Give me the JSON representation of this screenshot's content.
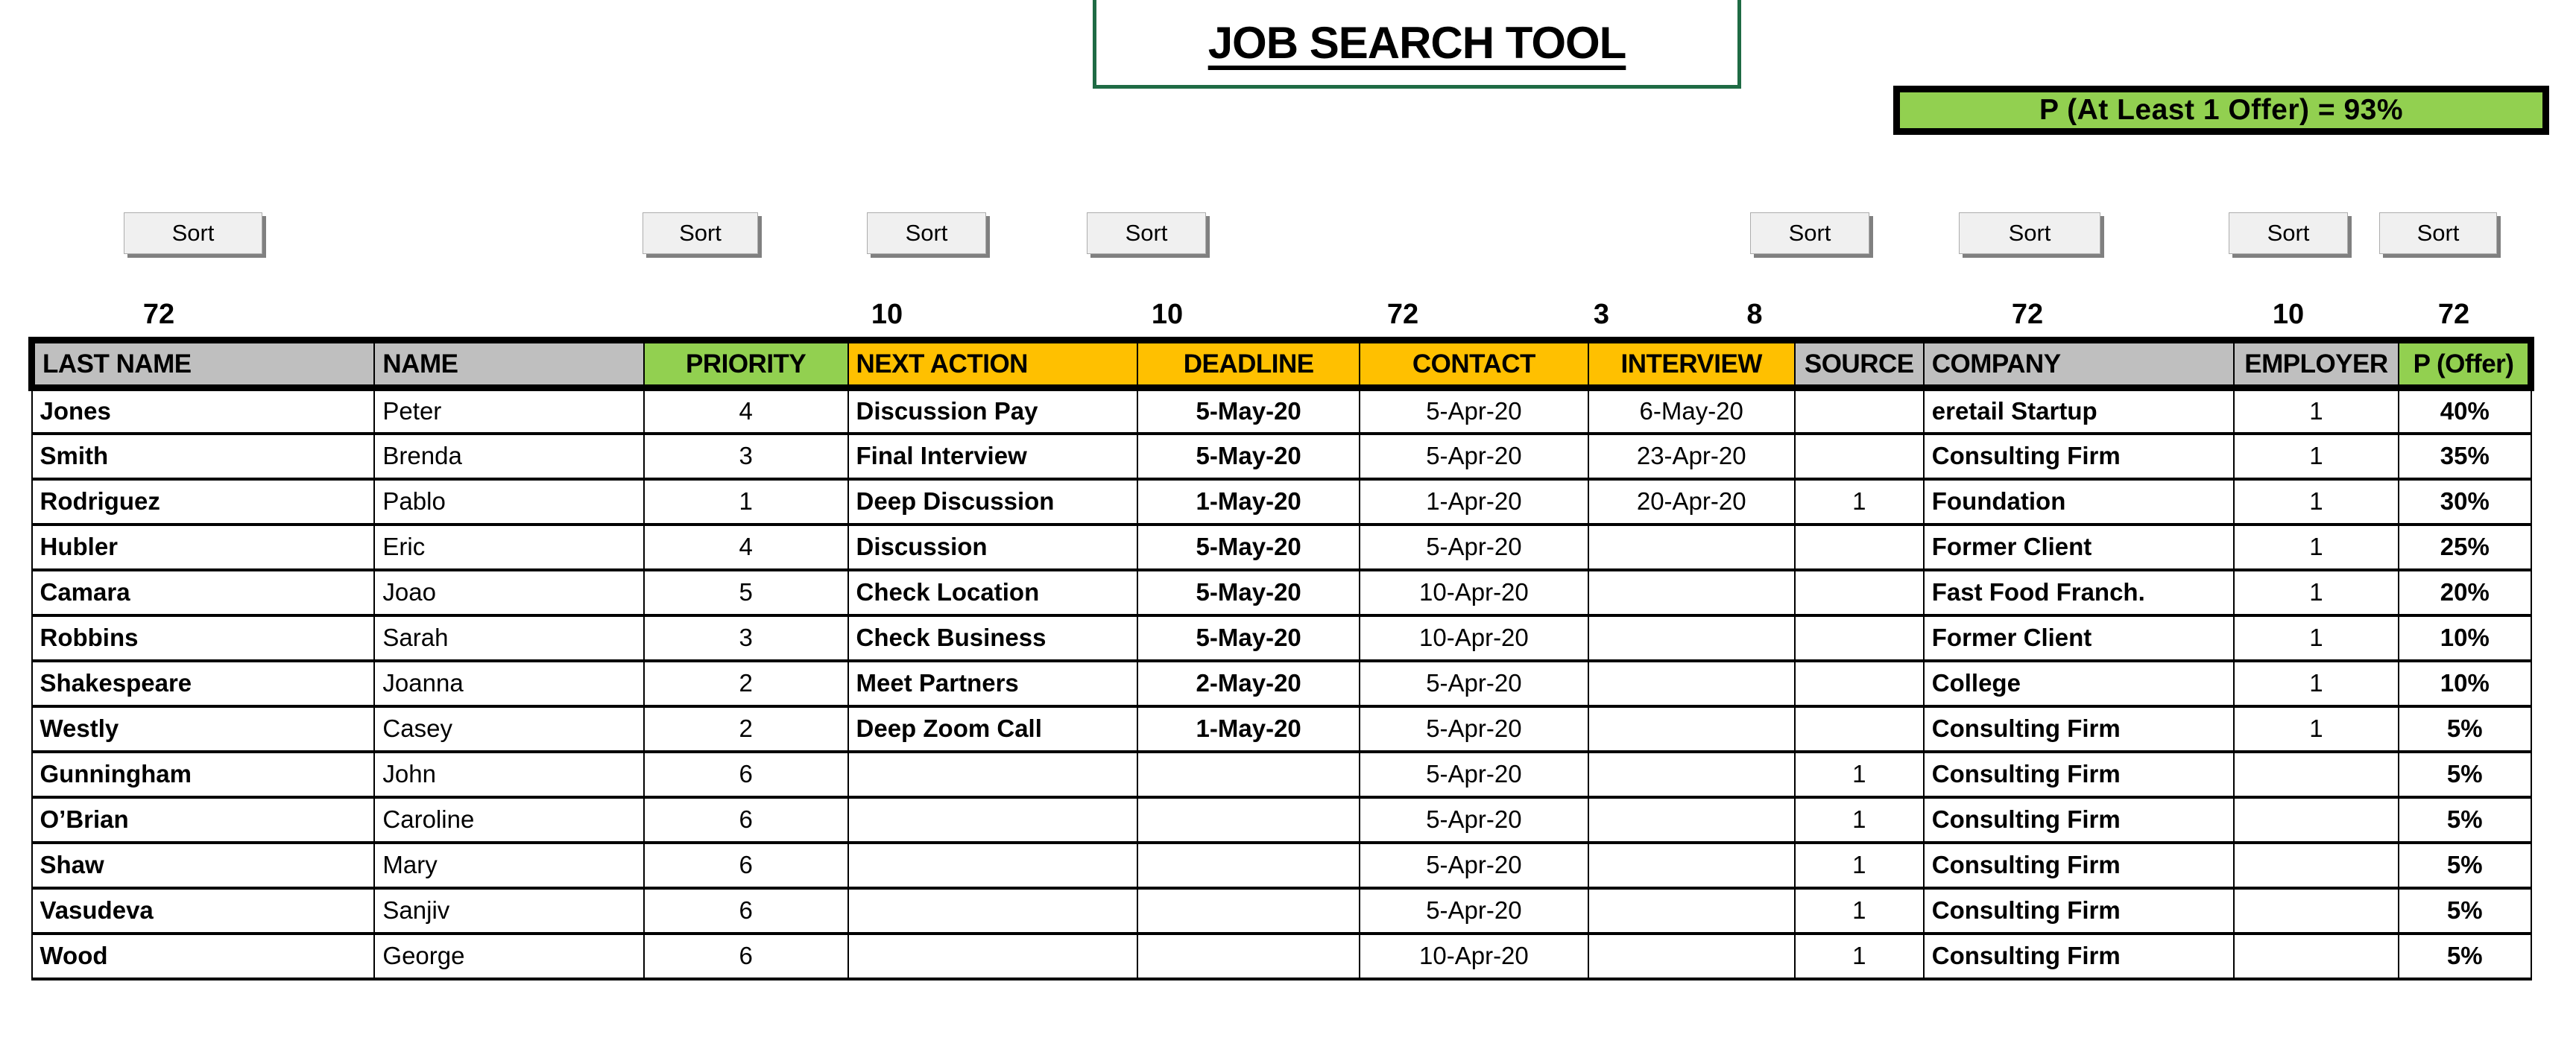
{
  "title": {
    "text": "JOB SEARCH TOOL"
  },
  "probability_banner": {
    "text": "P (At Least 1 Offer) = 93%"
  },
  "sort_label": "Sort",
  "sort_buttons": [
    {
      "column": "last-name",
      "label": "Sort"
    },
    {
      "column": "priority",
      "label": "Sort"
    },
    {
      "column": "next-action",
      "label": "Sort"
    },
    {
      "column": "deadline",
      "label": "Sort"
    },
    {
      "column": "source",
      "label": "Sort"
    },
    {
      "column": "company",
      "label": "Sort"
    },
    {
      "column": "employer",
      "label": "Sort"
    },
    {
      "column": "p-offer",
      "label": "Sort"
    }
  ],
  "counts": {
    "last_name": "72",
    "next_action": "10",
    "deadline": "10",
    "contact": "72",
    "interview": "3",
    "source": "8",
    "company": "72",
    "employer": "10",
    "p_offer": "72"
  },
  "table": {
    "columns": [
      {
        "key": "last_name",
        "label": "LAST NAME",
        "color": "#BFBFBF",
        "align": "left",
        "bold_cells": true
      },
      {
        "key": "name",
        "label": "NAME",
        "color": "#BFBFBF",
        "align": "left",
        "bold_cells": false
      },
      {
        "key": "priority",
        "label": "PRIORITY",
        "color": "#92D050",
        "align": "center",
        "bold_cells": false
      },
      {
        "key": "next_action",
        "label": "NEXT ACTION",
        "color": "#FFC000",
        "align": "left",
        "bold_cells": true
      },
      {
        "key": "deadline",
        "label": "DEADLINE",
        "color": "#FFC000",
        "align": "center",
        "bold_cells": true
      },
      {
        "key": "contact",
        "label": "CONTACT",
        "color": "#FFC000",
        "align": "center",
        "bold_cells": false
      },
      {
        "key": "interview",
        "label": "INTERVIEW",
        "color": "#FFC000",
        "align": "center",
        "bold_cells": false
      },
      {
        "key": "source",
        "label": "SOURCE",
        "color": "#BFBFBF",
        "align": "center",
        "bold_cells": false
      },
      {
        "key": "company",
        "label": "COMPANY",
        "color": "#BFBFBF",
        "align": "left",
        "bold_cells": true
      },
      {
        "key": "employer",
        "label": "EMPLOYER",
        "color": "#BFBFBF",
        "align": "center",
        "bold_cells": false
      },
      {
        "key": "p_offer",
        "label": "P (Offer)",
        "color": "#92D050",
        "align": "center",
        "bold_cells": true
      }
    ],
    "rows": [
      {
        "last_name": "Jones",
        "name": "Peter",
        "priority": "4",
        "next_action": "Discussion Pay",
        "deadline": "5-May-20",
        "contact": "5-Apr-20",
        "interview": "6-May-20",
        "source": "",
        "company": "eretail Startup",
        "employer": "1",
        "p_offer": "40%"
      },
      {
        "last_name": "Smith",
        "name": "Brenda",
        "priority": "3",
        "next_action": "Final Interview",
        "deadline": "5-May-20",
        "contact": "5-Apr-20",
        "interview": "23-Apr-20",
        "source": "",
        "company": "Consulting Firm",
        "employer": "1",
        "p_offer": "35%"
      },
      {
        "last_name": "Rodriguez",
        "name": "Pablo",
        "priority": "1",
        "next_action": "Deep Discussion",
        "deadline": "1-May-20",
        "contact": "1-Apr-20",
        "interview": "20-Apr-20",
        "source": "1",
        "company": "Foundation",
        "employer": "1",
        "p_offer": "30%"
      },
      {
        "last_name": "Hubler",
        "name": "Eric",
        "priority": "4",
        "next_action": "Discussion",
        "deadline": "5-May-20",
        "contact": "5-Apr-20",
        "interview": "",
        "source": "",
        "company": "Former Client",
        "employer": "1",
        "p_offer": "25%"
      },
      {
        "last_name": "Camara",
        "name": "Joao",
        "priority": "5",
        "next_action": "Check Location",
        "deadline": "5-May-20",
        "contact": "10-Apr-20",
        "interview": "",
        "source": "",
        "company": "Fast Food Franch.",
        "employer": "1",
        "p_offer": "20%"
      },
      {
        "last_name": "Robbins",
        "name": "Sarah",
        "priority": "3",
        "next_action": "Check Business",
        "deadline": "5-May-20",
        "contact": "10-Apr-20",
        "interview": "",
        "source": "",
        "company": "Former Client",
        "employer": "1",
        "p_offer": "10%"
      },
      {
        "last_name": "Shakespeare",
        "name": "Joanna",
        "priority": "2",
        "next_action": "Meet Partners",
        "deadline": "2-May-20",
        "contact": "5-Apr-20",
        "interview": "",
        "source": "",
        "company": "College",
        "employer": "1",
        "p_offer": "10%"
      },
      {
        "last_name": "Westly",
        "name": "Casey",
        "priority": "2",
        "next_action": "Deep Zoom Call",
        "deadline": "1-May-20",
        "contact": "5-Apr-20",
        "interview": "",
        "source": "",
        "company": "Consulting Firm",
        "employer": "1",
        "p_offer": "5%"
      },
      {
        "last_name": "Gunningham",
        "name": "John",
        "priority": "6",
        "next_action": "",
        "deadline": "",
        "contact": "5-Apr-20",
        "interview": "",
        "source": "1",
        "company": "Consulting Firm",
        "employer": "",
        "p_offer": "5%"
      },
      {
        "last_name": "O’Brian",
        "name": "Caroline",
        "priority": "6",
        "next_action": "",
        "deadline": "",
        "contact": "5-Apr-20",
        "interview": "",
        "source": "1",
        "company": "Consulting Firm",
        "employer": "",
        "p_offer": "5%"
      },
      {
        "last_name": "Shaw",
        "name": "Mary",
        "priority": "6",
        "next_action": "",
        "deadline": "",
        "contact": "5-Apr-20",
        "interview": "",
        "source": "1",
        "company": "Consulting Firm",
        "employer": "",
        "p_offer": "5%"
      },
      {
        "last_name": "Vasudeva",
        "name": "Sanjiv",
        "priority": "6",
        "next_action": "",
        "deadline": "",
        "contact": "5-Apr-20",
        "interview": "",
        "source": "1",
        "company": "Consulting Firm",
        "employer": "",
        "p_offer": "5%"
      },
      {
        "last_name": "Wood",
        "name": "George",
        "priority": "6",
        "next_action": "",
        "deadline": "",
        "contact": "10-Apr-20",
        "interview": "",
        "source": "1",
        "company": "Consulting Firm",
        "employer": "",
        "p_offer": "5%"
      }
    ]
  },
  "colors": {
    "header_gray": "#BFBFBF",
    "header_green": "#92D050",
    "header_amber": "#FFC000",
    "title_border_green": "#1F6B44",
    "banner_green": "#92D050"
  }
}
